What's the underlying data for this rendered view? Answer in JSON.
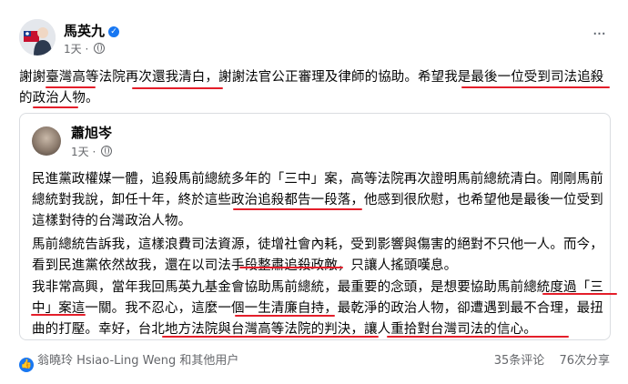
{
  "post": {
    "author": "馬英九",
    "time": "1天",
    "text": "謝謝臺灣高等法院再次還我清白，謝謝法官公正審理及律師的協助。希望我是最後一位受到司法追殺的政治人物。",
    "more_icon": "more-horizontal-icon"
  },
  "shared": {
    "author": "蕭旭岑",
    "time": "1天",
    "paragraphs": [
      "民進黨政權媒一體，追殺馬前總統多年的「三中」案，高等法院再次證明馬前總統清白。剛剛馬前總統對我說，卸任十年，終於這些政治追殺都告一段落，他感到很欣慰，也希望他是最後一位受到這樣對待的台灣政治人物。",
      "馬前總統告訴我，這樣浪費司法資源，徒增社會內耗，受到影響與傷害的絕對不只他一人。而今，看到民進黨依然故我，還在以司法手段整肅追殺政敵，只讓人搖頭嘆息。",
      "我非常高興，當年我回馬英九基金會協助馬前總統，最重要的念頭，是想要協助馬前總統度過「三中」案這一關。我不忍心，這麼一個一生清廉自持，最乾淨的政治人物，卻遭遇到最不合理，最扭曲的打壓。幸好，台北地方法院與台灣高等法院的判決，讓人重拾對台灣司法的信心。"
    ]
  },
  "footer": {
    "reactions": "翁曉玲 Hsiao-Ling Weng 和其他用户",
    "comments": "35条评论",
    "shares": "76次分享"
  },
  "colors": {
    "underline": "#e41e2a",
    "verified": "#1877f2",
    "meta": "#65676b"
  }
}
